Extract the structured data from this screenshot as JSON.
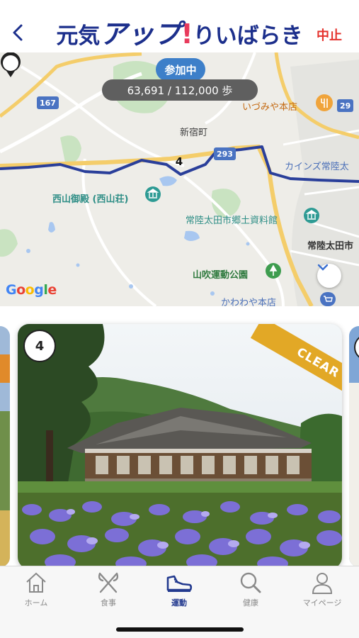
{
  "header": {
    "logo_part1": "元気",
    "logo_part2": "アップ",
    "logo_bang": "!",
    "logo_part3": "りいばらき",
    "quit_label": "中止"
  },
  "map": {
    "status_chip": "参加中",
    "steps": "63,691 / 112,000 歩",
    "marker_number": "4",
    "labels": {
      "izumiya": "いづみや本店",
      "shinjuku": "新宿町",
      "cainz": "カインズ常陸太",
      "nishiyama": "西山御殿 (西山荘)",
      "museum": "常陸太田市郷土資料館",
      "hitachiota": "常陸太田市",
      "yamabuki": "山吹運動公園",
      "kawawaya": "かわわや本店"
    },
    "road_badges": [
      "167",
      "293",
      "29"
    ],
    "google": [
      "G",
      "o",
      "o",
      "g",
      "l",
      "e"
    ],
    "route_color": "#2a3f9a"
  },
  "card": {
    "number": "4",
    "badge": "CLEAR",
    "badge_color": "#e2a826"
  },
  "tabs": [
    {
      "label": "ホーム",
      "icon": "home-icon"
    },
    {
      "label": "食事",
      "icon": "fork-knife-icon"
    },
    {
      "label": "運動",
      "icon": "sneaker-icon"
    },
    {
      "label": "健康",
      "icon": "search-icon"
    },
    {
      "label": "マイページ",
      "icon": "person-icon"
    }
  ],
  "active_tab": "運動",
  "colors": {
    "brand_navy": "#1c2f8c",
    "accent_red": "#e5322d",
    "chip_blue": "#3d7fc9"
  }
}
